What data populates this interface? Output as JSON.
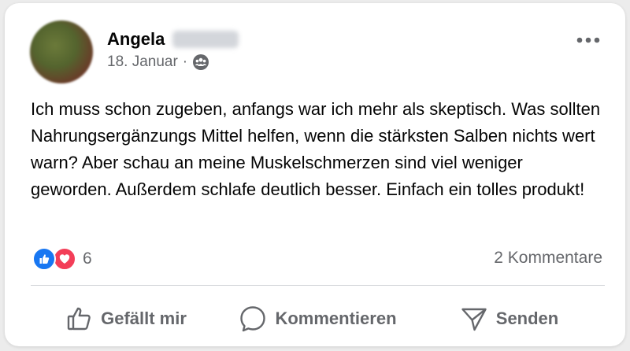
{
  "post": {
    "author_first_name": "Angela",
    "date": "18. Januar",
    "meta_separator": "·",
    "audience_icon": "friends-icon",
    "more_icon": "more-options-icon",
    "text": "Ich muss schon zugeben, anfangs war ich mehr als skeptisch. Was sollten Nahrungsergänzungs Mittel helfen, wenn die stärksten Salben nichts wert warn? Aber schau an meine Muskelschmerzen sind viel weniger geworden. Außerdem schlafe deutlich besser. Einfach ein tolles produkt!"
  },
  "reactions": {
    "count": "6",
    "icons": [
      "like-reaction-icon",
      "love-reaction-icon"
    ],
    "comments_label": "2 Kommentare"
  },
  "actions": {
    "like_label": "Gefällt mir",
    "comment_label": "Kommentieren",
    "send_label": "Senden"
  },
  "colors": {
    "like_blue": "#1877f2",
    "love_red": "#f33e58",
    "secondary_text": "#65676b",
    "primary_text": "#050505"
  }
}
